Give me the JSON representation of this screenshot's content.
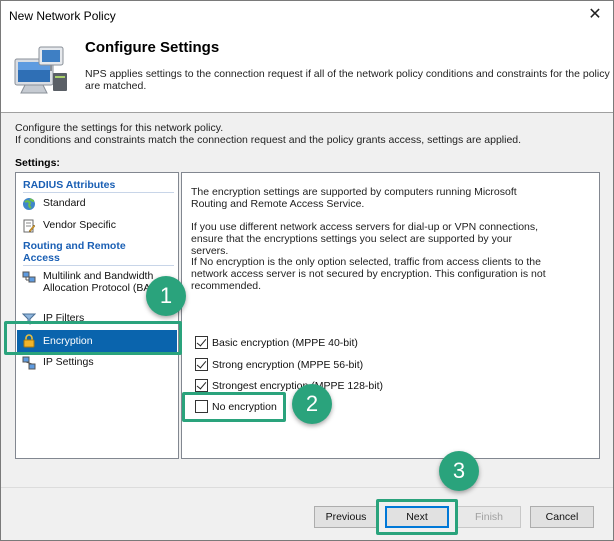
{
  "window": {
    "title": "New Network Policy",
    "close_glyph": "✕"
  },
  "header": {
    "title": "Configure Settings",
    "description": "NPS applies settings to the connection request if all of the network policy conditions and constraints for the policy are matched.",
    "icon": "network-computer-icon"
  },
  "intro": {
    "line1": "Configure the settings for this network policy.",
    "line2": "If conditions and constraints match the connection request and the policy grants access, settings are applied."
  },
  "settings_label": "Settings:",
  "nav": {
    "group1": "RADIUS Attributes",
    "standard": "Standard",
    "vendor_specific": "Vendor Specific",
    "group2": "Routing and Remote Access",
    "multilink": "Multilink and Bandwidth Allocation Protocol (BAP)",
    "ip_filters": "IP Filters",
    "encryption": "Encryption",
    "ip_settings": "IP Settings"
  },
  "content": {
    "p1": "The encryption settings are supported by computers running Microsoft Routing and Remote Access Service.",
    "p2": "If you use different network access servers for dial-up or VPN connections, ensure that the encryptions settings you select are supported by your servers.",
    "p3": "If No encryption is the only option selected, traffic from access clients to the network access server is not secured by encryption. This configuration is not recommended.",
    "options": [
      {
        "label": "Basic encryption (MPPE 40-bit)",
        "checked": true
      },
      {
        "label": "Strong encryption (MPPE 56-bit)",
        "checked": true
      },
      {
        "label": "Strongest encryption (MPPE 128-bit)",
        "checked": true
      },
      {
        "label": "No encryption",
        "checked": false
      }
    ]
  },
  "buttons": {
    "previous": "Previous",
    "next": "Next",
    "finish": "Finish",
    "cancel": "Cancel"
  },
  "callouts": {
    "one": "1",
    "two": "2",
    "three": "3"
  },
  "colors": {
    "accent": "#2aa37c",
    "selection": "#0a64ad",
    "group_heading": "#1a5fb4"
  }
}
